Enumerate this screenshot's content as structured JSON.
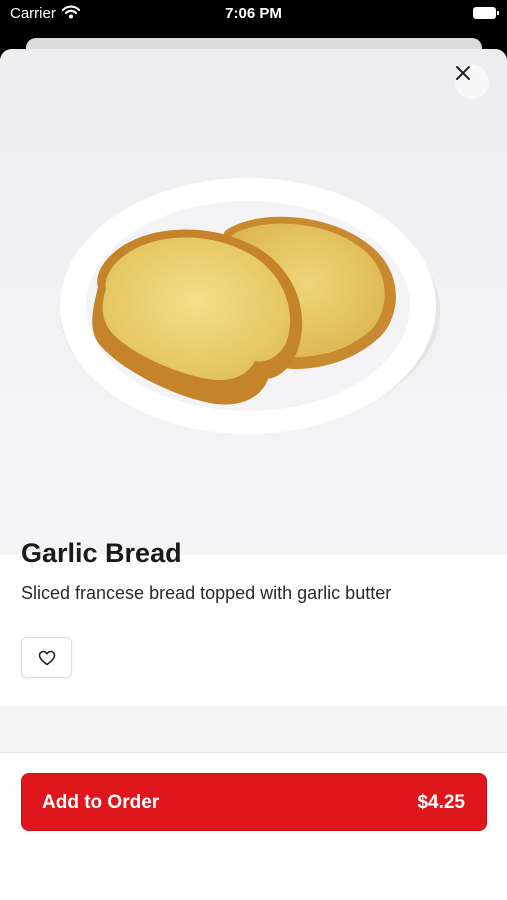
{
  "status_bar": {
    "carrier": "Carrier",
    "time": "7:06 PM"
  },
  "item": {
    "name": "Garlic Bread",
    "description": "Sliced francese bread topped with garlic butter"
  },
  "order_button": {
    "label": "Add to Order",
    "price": "$4.25"
  },
  "colors": {
    "accent": "#e0161d",
    "text": "#1a1a1a"
  },
  "icons": {
    "close": "close-icon",
    "favorite": "heart-icon",
    "wifi": "wifi-icon",
    "battery": "battery-icon"
  }
}
